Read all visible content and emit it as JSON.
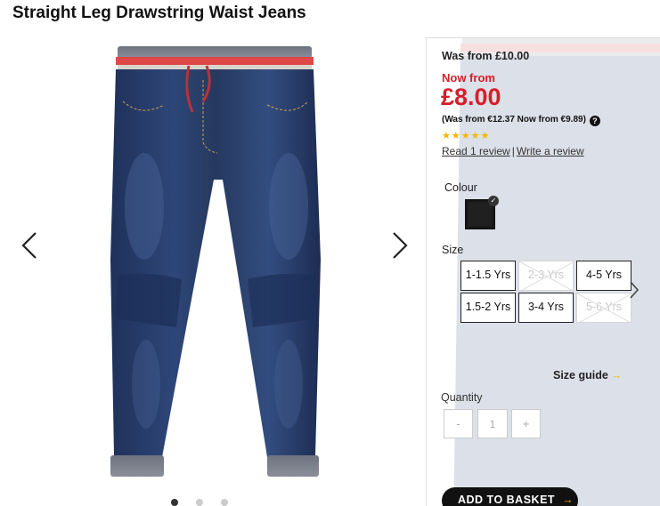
{
  "product": {
    "title": "Straight Leg Drawstring Waist Jeans"
  },
  "gallery": {
    "prev_icon": "chevron-left-icon",
    "next_icon": "chevron-right-icon",
    "image_count": 3,
    "active_index": 0
  },
  "pricing": {
    "was_text": "Was from £10.00",
    "now_label": "Now from",
    "price": "£8.00",
    "euro_text": "(Was from €12.37 Now from €9.89)",
    "help_icon": "?",
    "sale_color": "#d51e2a"
  },
  "rating": {
    "stars": 5,
    "star_glyphs": "★★★★★",
    "star_color": "#f2b600",
    "read_reviews": "Read 1 review",
    "separator": "|",
    "write_review": "Write a review"
  },
  "colour": {
    "label": "Colour",
    "selected_swatch": "#1a1a1a"
  },
  "size": {
    "label": "Size",
    "options": [
      {
        "label": "1-1.5 Yrs",
        "available": true
      },
      {
        "label": "2-3 Yrs",
        "available": false
      },
      {
        "label": "4-5 Yrs",
        "available": true
      },
      {
        "label": "1.5-2 Yrs",
        "available": true
      },
      {
        "label": "3-4 Yrs",
        "available": true
      },
      {
        "label": "5-6 Yrs",
        "available": false
      }
    ],
    "guide_label": "Size guide",
    "guide_arrow": "→"
  },
  "quantity": {
    "label": "Quantity",
    "minus": "-",
    "value": "1",
    "plus": "+"
  },
  "basket": {
    "label": "ADD TO BASKET",
    "arrow": "→"
  }
}
